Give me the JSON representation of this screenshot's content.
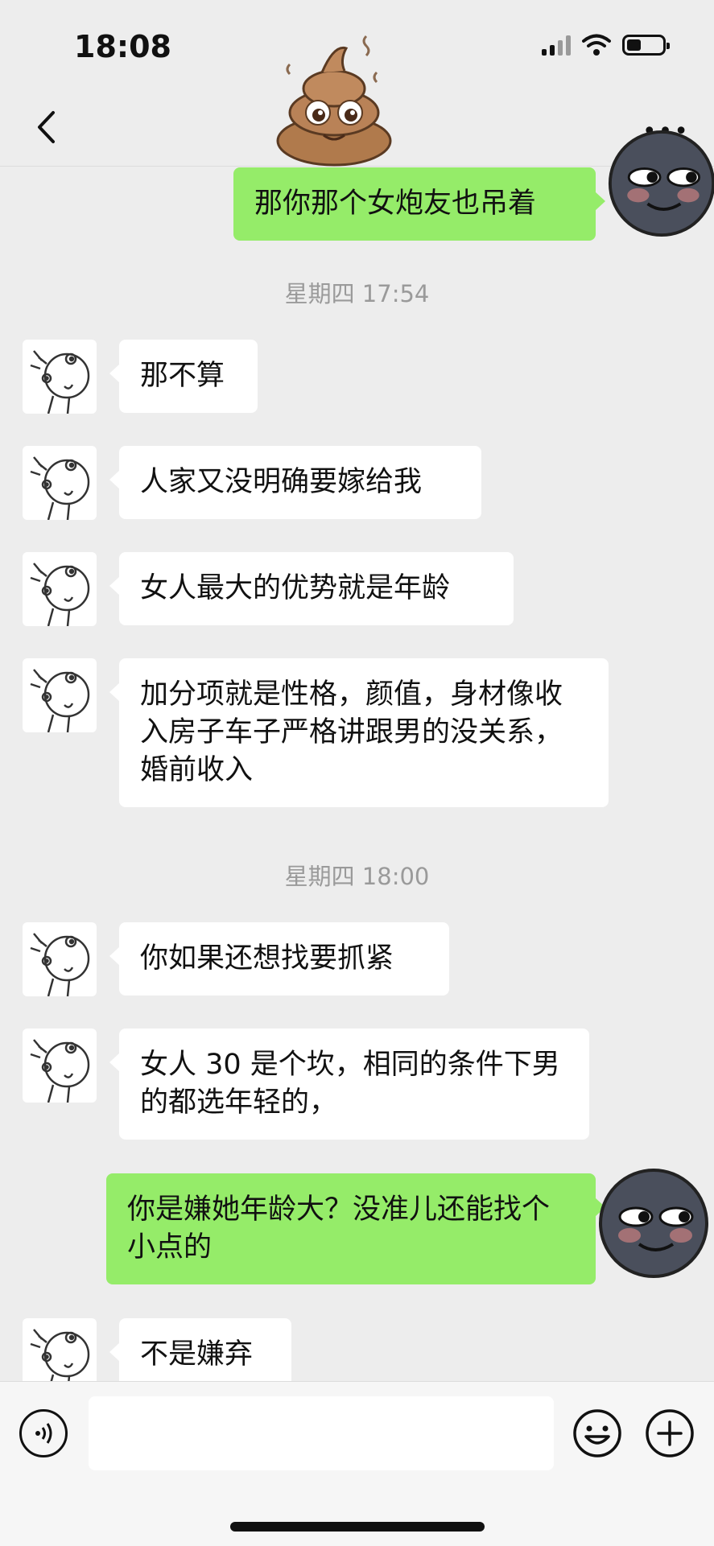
{
  "status_bar": {
    "time": "18:08",
    "battery_level": 0.35
  },
  "nav": {
    "back_icon": "chevron-left-icon",
    "more_icon": "more-dots-icon",
    "title_sticker": "poop-emoji"
  },
  "messages": [
    {
      "side": "out",
      "text": "那你那个女炮友也吊着"
    },
    {
      "timestamp": "星期四 17:54"
    },
    {
      "side": "in",
      "text": "那不算"
    },
    {
      "side": "in",
      "text": "人家又没明确要嫁给我"
    },
    {
      "side": "in",
      "text": "女人最大的优势就是年龄"
    },
    {
      "side": "in",
      "text": "加分项就是性格，颜值，身材像收入房子车子严格讲跟男的没关系，婚前收入"
    },
    {
      "timestamp": "星期四 18:00"
    },
    {
      "side": "in",
      "text": "你如果还想找要抓紧"
    },
    {
      "side": "in",
      "text": "女人 30 是个坎，相同的条件下男的都选年轻的，"
    },
    {
      "side": "out",
      "text": "你是嫌她年龄大？没准儿还能找个小点的"
    },
    {
      "side": "in",
      "text": "不是嫌弃"
    }
  ],
  "input": {
    "value": "",
    "voice_icon": "voice-icon",
    "emoji_icon": "emoji-icon",
    "plus_icon": "plus-icon"
  },
  "colors": {
    "background": "#ededed",
    "outgoing_bubble": "#95ec69",
    "incoming_bubble": "#ffffff",
    "timestamp": "#9a9a9a"
  }
}
